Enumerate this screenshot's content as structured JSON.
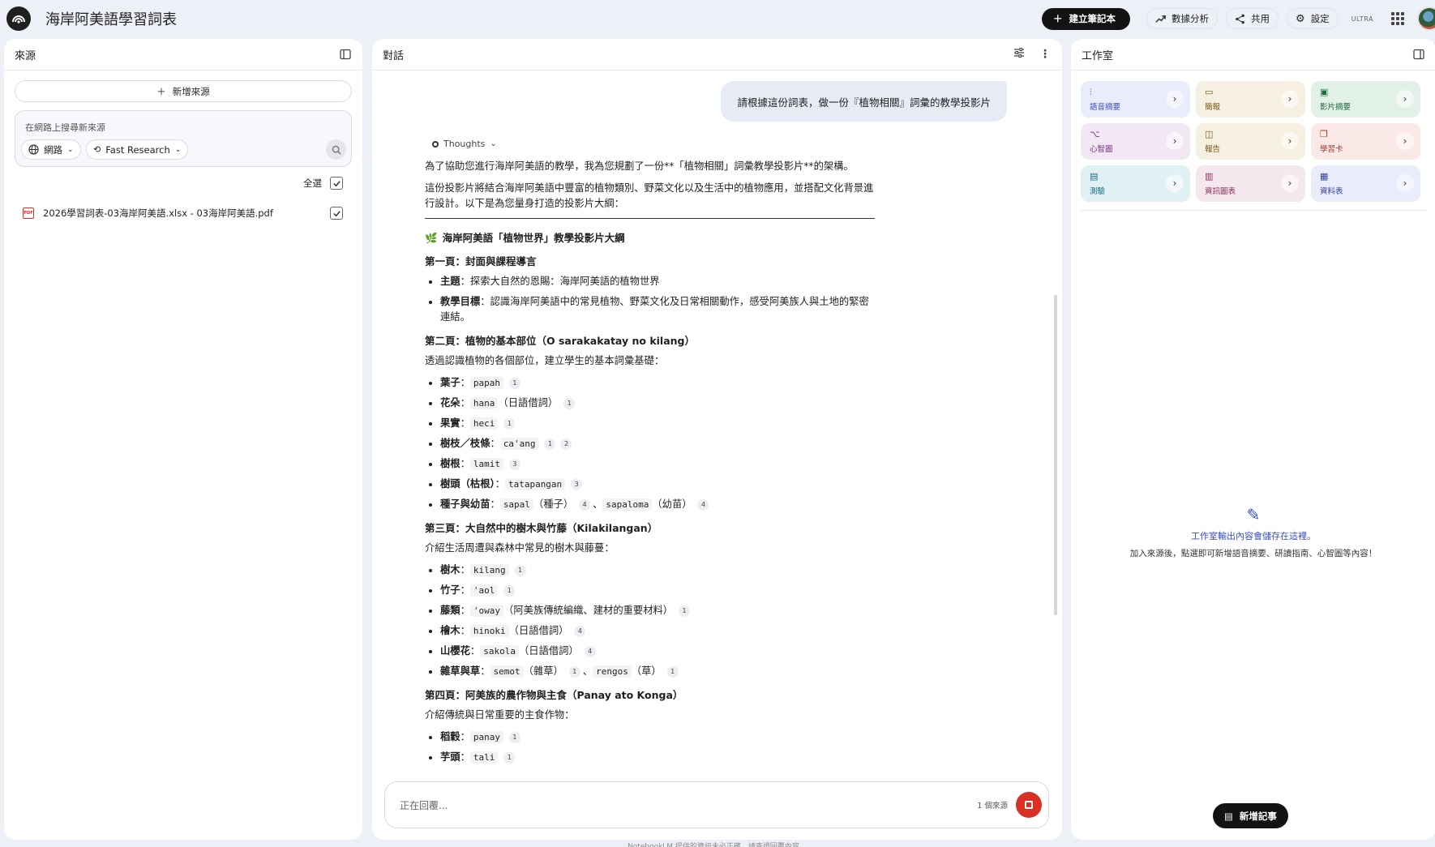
{
  "app": {
    "title": "海岸阿美語學習詞表"
  },
  "topbar": {
    "create_label": "建立筆記本",
    "analytics_label": "數據分析",
    "share_label": "共用",
    "settings_label": "設定",
    "plan_badge": "ULTRA"
  },
  "sources": {
    "title": "來源",
    "add_label": "新增來源",
    "search_placeholder": "在網路上搜尋新來源",
    "web_chip": "網路",
    "research_chip": "Fast Research",
    "select_all": "全選",
    "items": [
      {
        "name": "2026學習詞表-03海岸阿美語.xlsx - 03海岸阿美語.pdf",
        "icon": "PDF",
        "checked": true
      }
    ]
  },
  "chat": {
    "title": "對話",
    "user_message": "請根據這份詞表，做一份『植物相關』詞彙的教學投影片",
    "thoughts_label": "Thoughts",
    "intro1": "為了協助您進行海岸阿美語的教學，我為您規劃了一份**「植物相關」詞彙教學投影片**的架構。",
    "intro2": "這份投影片將結合海岸阿美語中豐富的植物類別、野菜文化以及生活中的植物應用，並搭配文化背景進行設計。以下是為您量身打造的投影片大綱：",
    "outline_title": "海岸阿美語「植物世界」教學投影片大綱",
    "s1": {
      "heading": "第一頁：封面與課程導言",
      "b1_label": "主題",
      "b1_text": "：探索大自然的恩賜：海岸阿美語的植物世界",
      "b2_label": "教學目標",
      "b2_text": "：認識海岸阿美語中的常見植物、野菜文化及日常相關動作，感受阿美族人與土地的緊密連結。"
    },
    "s2": {
      "heading": "第二頁：植物的基本部位（O sarakakatay no kilang）",
      "desc": "透過認識植物的各個部位，建立學生的基本詞彙基礎：",
      "i1_label": "葉子",
      "i1_word": "papah",
      "i1_c": "1",
      "i2_label": "花朵",
      "i2_word": "hana",
      "i2_note": "（日語借詞）",
      "i2_c": "1",
      "i3_label": "果實",
      "i3_word": "heci",
      "i3_c": "1",
      "i4_label": "樹枝／枝條",
      "i4_word": "ca'ang",
      "i4_c1": "1",
      "i4_c2": "2",
      "i5_label": "樹根",
      "i5_word": "lamit",
      "i5_c": "3",
      "i6_label": "樹頭（枯根）",
      "i6_word": "tatapangan",
      "i6_c": "3",
      "i7_label": "種子與幼苗",
      "i7_word1": "sapal",
      "i7_note1": "（種子）",
      "i7_c1": "4",
      "i7_sep": "、",
      "i7_word2": "sapaloma",
      "i7_note2": "（幼苗）",
      "i7_c2": "4"
    },
    "s3": {
      "heading": "第三頁：大自然中的樹木與竹藤（Kilakilangan）",
      "desc": "介紹生活周遭與森林中常見的樹木與藤蔓：",
      "i1_label": "樹木",
      "i1_word": "kilang",
      "i1_c": "1",
      "i2_label": "竹子",
      "i2_word": "'aol",
      "i2_c": "1",
      "i3_label": "藤類",
      "i3_word": "'oway",
      "i3_note": "（阿美族傳統編織、建材的重要材料）",
      "i3_c": "1",
      "i4_label": "檜木",
      "i4_word": "hinoki",
      "i4_note": "（日語借詞）",
      "i4_c": "4",
      "i5_label": "山櫻花",
      "i5_word": "sakola",
      "i5_note": "（日語借詞）",
      "i5_c": "4",
      "i6_label": "雜草與草",
      "i6_word1": "semot",
      "i6_note1": "（雜草）",
      "i6_c1": "1",
      "i6_sep": "、",
      "i6_word2": "rengos",
      "i6_note2": "（草）",
      "i6_c2": "1"
    },
    "s4": {
      "heading": "第四頁：阿美族的農作物與主食（Panay ato Konga）",
      "desc": "介紹傳統與日常重要的主食作物：",
      "i1_label": "稻穀",
      "i1_word": "panay",
      "i1_c": "1",
      "i2_label": "芋頭",
      "i2_word": "tali",
      "i2_c": "1"
    },
    "input_placeholder": "正在回覆...",
    "source_count": "1 個來源",
    "footer_note": "NotebookLM 提供的資訊未必正確，請查證回覆內容。"
  },
  "studio": {
    "title": "工作室",
    "tiles": [
      {
        "label": "語音摘要",
        "icon": "audio-icon"
      },
      {
        "label": "簡報",
        "icon": "slides-icon"
      },
      {
        "label": "影片摘要",
        "icon": "video-icon"
      },
      {
        "label": "心智圖",
        "icon": "mindmap-icon"
      },
      {
        "label": "報告",
        "icon": "report-icon"
      },
      {
        "label": "學習卡",
        "icon": "flashcard-icon"
      },
      {
        "label": "測驗",
        "icon": "quiz-icon"
      },
      {
        "label": "資訊圖表",
        "icon": "infographic-icon"
      },
      {
        "label": "資料表",
        "icon": "datatable-icon"
      }
    ],
    "empty_title": "工作室輸出內容會儲存在這裡。",
    "empty_sub": "加入來源後，點選即可新增語音摘要、研讀指南、心智圖等內容！",
    "add_note_label": "新增記事"
  }
}
